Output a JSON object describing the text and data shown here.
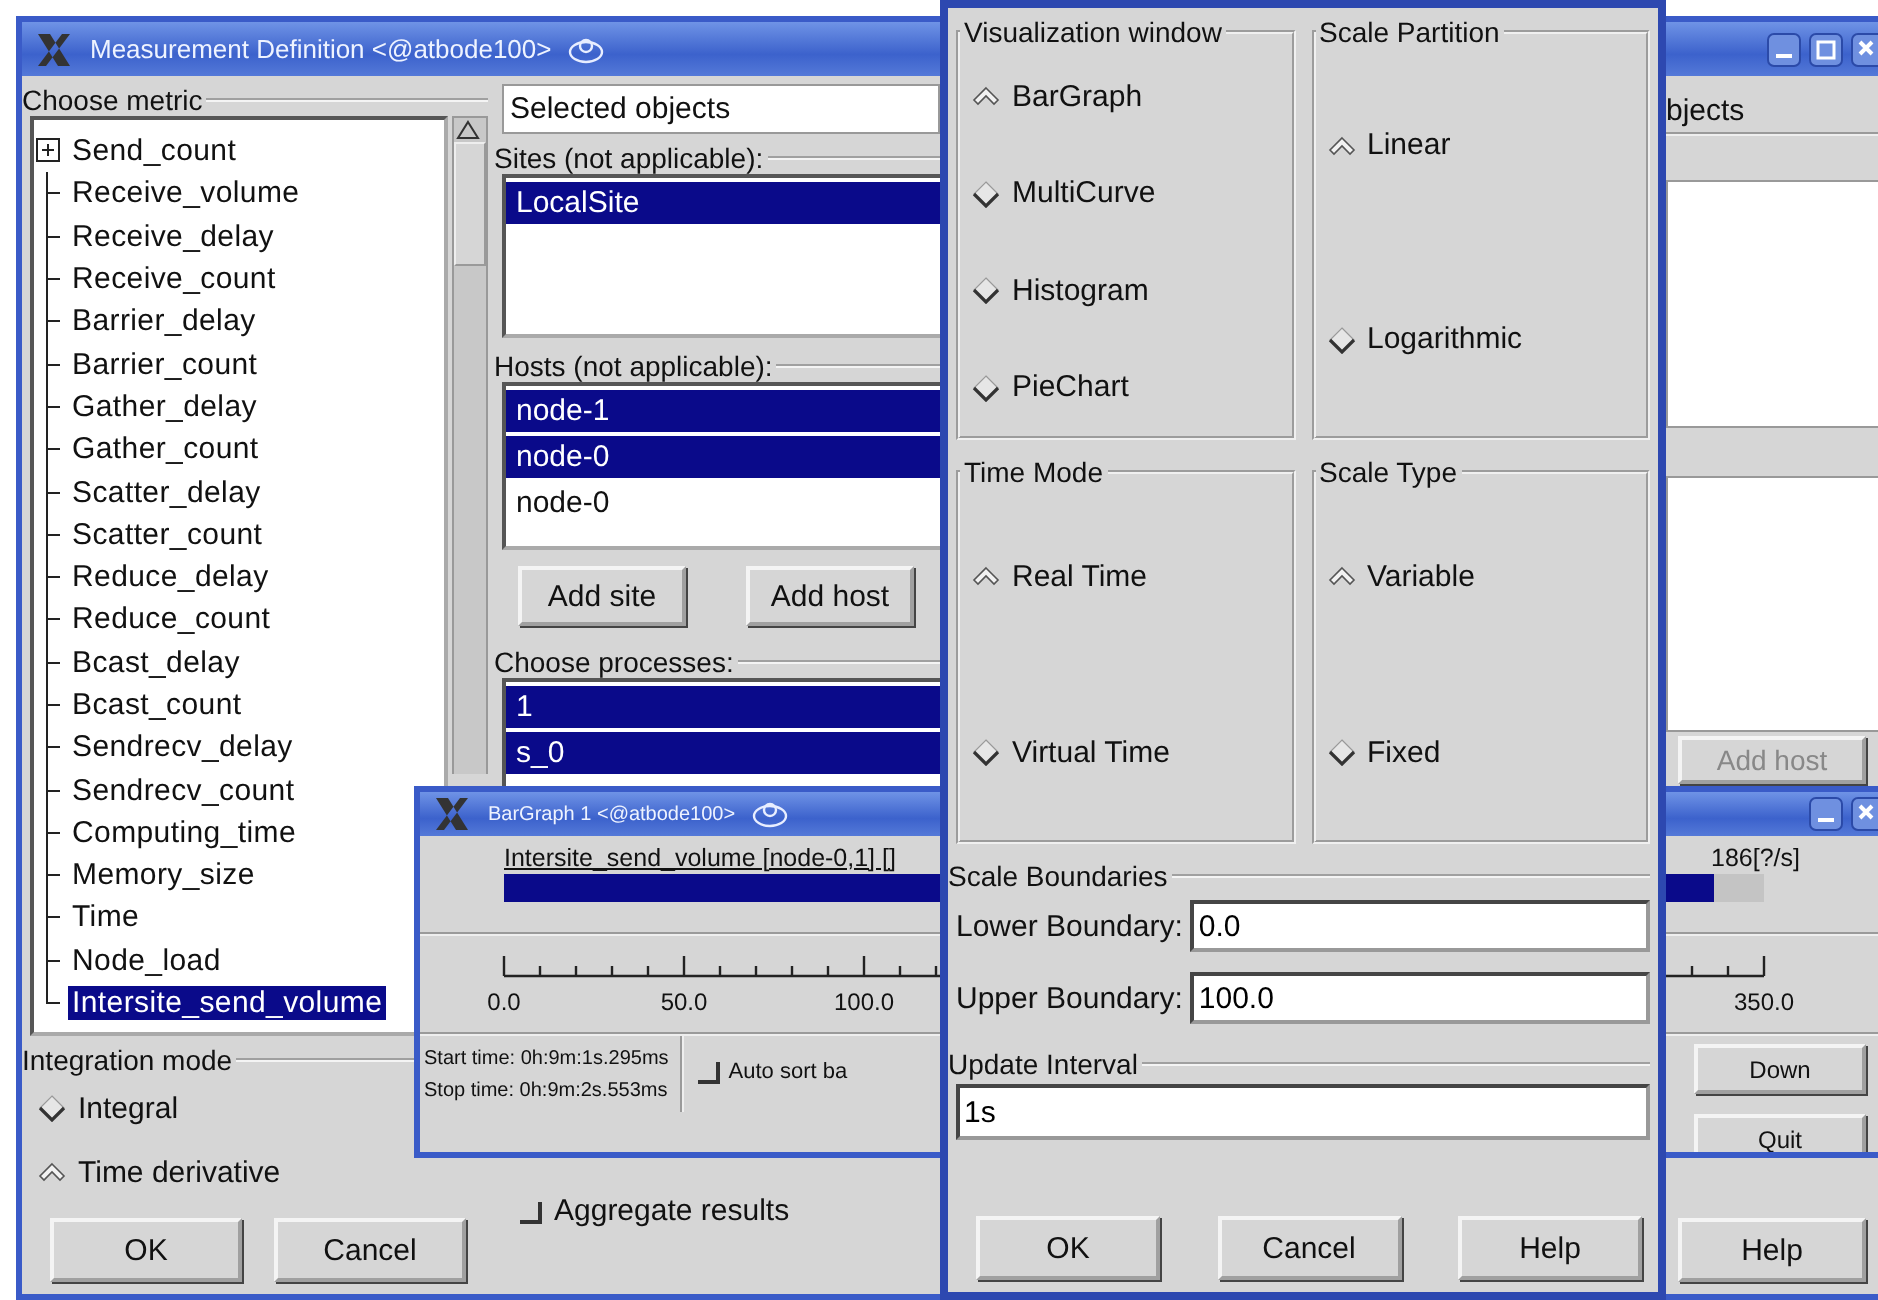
{
  "main_window": {
    "title": "Measurement Definition <@atbode100>",
    "metric": {
      "label": "Choose metric",
      "items": [
        {
          "label": "Send_count",
          "kind": "branch",
          "selected": false
        },
        {
          "label": "Receive_volume",
          "kind": "leaf",
          "selected": false
        },
        {
          "label": "Receive_delay",
          "kind": "leaf",
          "selected": false
        },
        {
          "label": "Receive_count",
          "kind": "leaf",
          "selected": false
        },
        {
          "label": "Barrier_delay",
          "kind": "leaf",
          "selected": false
        },
        {
          "label": "Barrier_count",
          "kind": "leaf",
          "selected": false
        },
        {
          "label": "Gather_delay",
          "kind": "leaf",
          "selected": false
        },
        {
          "label": "Gather_count",
          "kind": "leaf",
          "selected": false
        },
        {
          "label": "Scatter_delay",
          "kind": "leaf",
          "selected": false
        },
        {
          "label": "Scatter_count",
          "kind": "leaf",
          "selected": false
        },
        {
          "label": "Reduce_delay",
          "kind": "leaf",
          "selected": false
        },
        {
          "label": "Reduce_count",
          "kind": "leaf",
          "selected": false
        },
        {
          "label": "Bcast_delay",
          "kind": "leaf",
          "selected": false
        },
        {
          "label": "Bcast_count",
          "kind": "leaf",
          "selected": false
        },
        {
          "label": "Sendrecv_delay",
          "kind": "leaf",
          "selected": false
        },
        {
          "label": "Sendrecv_count",
          "kind": "leaf",
          "selected": false
        },
        {
          "label": "Computing_time",
          "kind": "leaf",
          "selected": false
        },
        {
          "label": "Memory_size",
          "kind": "leaf",
          "selected": false
        },
        {
          "label": "Time",
          "kind": "leaf",
          "selected": false
        },
        {
          "label": "Node_load",
          "kind": "leaf",
          "selected": false
        },
        {
          "label": "Intersite_send_volume",
          "kind": "leaf",
          "selected": true
        }
      ]
    },
    "integration_mode": {
      "label": "Integration mode",
      "options": [
        {
          "label": "Integral",
          "selected": false
        },
        {
          "label": "Time derivative",
          "selected": true
        }
      ]
    },
    "buttons": [
      "OK",
      "Cancel"
    ],
    "object_filter": {
      "value": "Selected objects"
    },
    "sites": {
      "label": "Sites (not applicable):",
      "items": [
        {
          "label": "LocalSite",
          "selected": true
        }
      ]
    },
    "hosts": {
      "label": "Hosts (not applicable):",
      "items": [
        {
          "label": "node-1",
          "selected": true
        },
        {
          "label": "node-0",
          "selected": true
        },
        {
          "label": "node-0",
          "selected": false
        }
      ]
    },
    "add_buttons": [
      "Add site",
      "Add host"
    ],
    "processes": {
      "label": "Choose processes:",
      "items": [
        {
          "label": "1",
          "selected": true
        },
        {
          "label": "s_0",
          "selected": true
        }
      ]
    },
    "aggregate": {
      "label": "Aggregate results",
      "checked": false
    },
    "right_edge": {
      "filter_text": "bjects",
      "add_host": {
        "label": "Add host",
        "disabled": true
      },
      "help": "Help"
    }
  },
  "bargraph_window": {
    "title": "BarGraph 1 <@atbode100>",
    "bar": {
      "label": "Intersite_send_volume [node-0,1] []",
      "value": "186[?/s]",
      "level": 0.96
    },
    "axis_labels": [
      "0.0",
      "50.0",
      "100.0"
    ],
    "axis_end_label": "350.0",
    "start_time": "Start time: 0h:9m:1s.295ms",
    "stop_time": "Stop time: 0h:9m:2s.553ms",
    "auto_sort": {
      "label": "Auto sort ba",
      "checked": false
    },
    "buttons": [
      "Down",
      "Quit"
    ]
  },
  "settings_dialog": {
    "groups": [
      {
        "label": "Visualization window",
        "options": [
          {
            "label": "BarGraph",
            "selected": true
          },
          {
            "label": "MultiCurve",
            "selected": false
          },
          {
            "label": "Histogram",
            "selected": false
          },
          {
            "label": "PieChart",
            "selected": false
          }
        ]
      },
      {
        "label": "Scale Partition",
        "options": [
          {
            "label": "Linear",
            "selected": true
          },
          {
            "label": "Logarithmic",
            "selected": false
          }
        ]
      },
      {
        "label": "Time Mode",
        "options": [
          {
            "label": "Real Time",
            "selected": true
          },
          {
            "label": "Virtual Time",
            "selected": false
          }
        ]
      },
      {
        "label": "Scale Type",
        "options": [
          {
            "label": "Variable",
            "selected": true
          },
          {
            "label": "Fixed",
            "selected": false
          }
        ]
      }
    ],
    "scale_boundaries": {
      "label": "Scale Boundaries",
      "fields": [
        {
          "label": "Lower Boundary:",
          "value": "0.0"
        },
        {
          "label": "Upper Boundary:",
          "value": "100.0"
        }
      ]
    },
    "update_interval": {
      "label": "Update Interval",
      "value": "1s"
    },
    "buttons": [
      "OK",
      "Cancel",
      "Help"
    ]
  }
}
